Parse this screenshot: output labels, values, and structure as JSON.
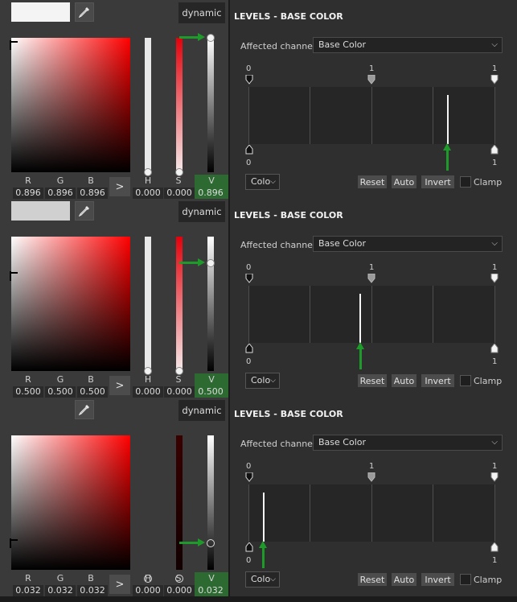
{
  "panels": [
    {
      "swatch_color": "#f4f4f4",
      "hue_color": "#ff0000",
      "cursor_level": 0.03,
      "dynamic_label": "dynamic",
      "labels": {
        "r": "R",
        "g": "G",
        "b": "B",
        "h": "H",
        "s": "S",
        "v": "V"
      },
      "values": {
        "r": "0.896",
        "g": "0.896",
        "b": "0.896",
        "h": "0.000",
        "s": "0.000",
        "v": "0.896"
      },
      "go_label": ">",
      "h_track": "solid",
      "s_track": "gradient",
      "knob_style": "filled",
      "v_level": 1.0,
      "levels": {
        "title": "LEVELS - BASE COLOR",
        "affected_label": "Affected channel:",
        "affected_value": "Base Color",
        "top_numbers": [
          "0",
          "1",
          "1"
        ],
        "bottom_numbers": [
          "0",
          "1"
        ],
        "spike_position": 0.896,
        "colo_label": "Colo",
        "reset_label": "Reset",
        "auto_label": "Auto",
        "invert_label": "Invert",
        "clamp_label": "Clamp"
      }
    },
    {
      "swatch_color": "#d0d0d0",
      "hue_color": "#ff0000",
      "cursor_level": 0.27,
      "dynamic_label": "dynamic",
      "labels": {
        "r": "R",
        "g": "G",
        "b": "B",
        "h": "H",
        "s": "S",
        "v": "V"
      },
      "values": {
        "r": "0.500",
        "g": "0.500",
        "b": "0.500",
        "h": "0.000",
        "s": "0.000",
        "v": "0.500"
      },
      "go_label": ">",
      "h_track": "solid",
      "s_track": "gradient",
      "knob_style": "filled",
      "v_level": 0.8,
      "levels": {
        "title": "LEVELS - BASE COLOR",
        "affected_label": "Affected channel:",
        "affected_value": "Base Color",
        "top_numbers": [
          "0",
          "1",
          "1"
        ],
        "bottom_numbers": [
          "0",
          "1"
        ],
        "spike_position": 0.5,
        "colo_label": "Colo",
        "reset_label": "Reset",
        "auto_label": "Auto",
        "invert_label": "Invert",
        "clamp_label": "Clamp"
      }
    },
    {
      "swatch_color": "",
      "hue_color": "#ff0000",
      "cursor_level": 0.78,
      "dynamic_label": "dynamic",
      "labels": {
        "r": "R",
        "g": "G",
        "b": "B",
        "h": "H",
        "s": "S",
        "v": "V"
      },
      "values": {
        "r": "0.032",
        "g": "0.032",
        "b": "0.032",
        "h": "0.000",
        "s": "0.000",
        "v": "0.032"
      },
      "go_label": ">",
      "h_track": "none",
      "s_track": "dark",
      "knob_style": "hollow",
      "v_level": 0.2,
      "levels": {
        "title": "LEVELS - BASE COLOR",
        "affected_label": "Affected channel:",
        "affected_value": "Base Color",
        "top_numbers": [
          "0",
          "1",
          "1"
        ],
        "bottom_numbers": [
          "0",
          "1"
        ],
        "spike_position": 0.032,
        "colo_label": "Colo",
        "reset_label": "Reset",
        "auto_label": "Auto",
        "invert_label": "Invert",
        "clamp_label": "Clamp"
      }
    }
  ],
  "colors": {
    "accent_green": "#1e9a2a",
    "v_highlight": "#2d6a31"
  }
}
